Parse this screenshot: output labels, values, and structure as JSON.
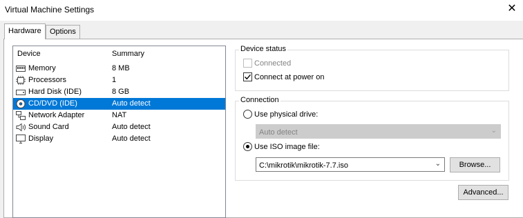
{
  "window": {
    "title": "Virtual Machine Settings",
    "close_glyph": "✕"
  },
  "tabs": [
    {
      "label": "Hardware",
      "active": true
    },
    {
      "label": "Options",
      "active": false
    }
  ],
  "device_list": {
    "columns": [
      "Device",
      "Summary"
    ],
    "rows": [
      {
        "icon": "memory-icon",
        "device": "Memory",
        "summary": "8 MB"
      },
      {
        "icon": "processor-icon",
        "device": "Processors",
        "summary": "1"
      },
      {
        "icon": "hard-disk-icon",
        "device": "Hard Disk (IDE)",
        "summary": "8 GB"
      },
      {
        "icon": "cd-dvd-icon",
        "device": "CD/DVD (IDE)",
        "summary": "Auto detect",
        "selected": true
      },
      {
        "icon": "network-adapter-icon",
        "device": "Network Adapter",
        "summary": "NAT"
      },
      {
        "icon": "sound-card-icon",
        "device": "Sound Card",
        "summary": "Auto detect"
      },
      {
        "icon": "display-icon",
        "device": "Display",
        "summary": "Auto detect"
      }
    ],
    "selection_color": "#0078d7"
  },
  "device_status": {
    "title": "Device status",
    "connected_label": "Connected",
    "connected_checked": false,
    "connected_enabled": false,
    "connect_at_power_on_label": "Connect at power on",
    "connect_at_power_on_checked": true
  },
  "connection": {
    "title": "Connection",
    "physical_drive_label": "Use physical drive:",
    "physical_drive_selected": false,
    "physical_drive_value": "Auto detect",
    "iso_label": "Use ISO image file:",
    "iso_selected": true,
    "iso_path": "C:\\mikrotik\\mikrotik-7.7.iso",
    "browse_label": "Browse..."
  },
  "advanced_label": "Advanced..."
}
